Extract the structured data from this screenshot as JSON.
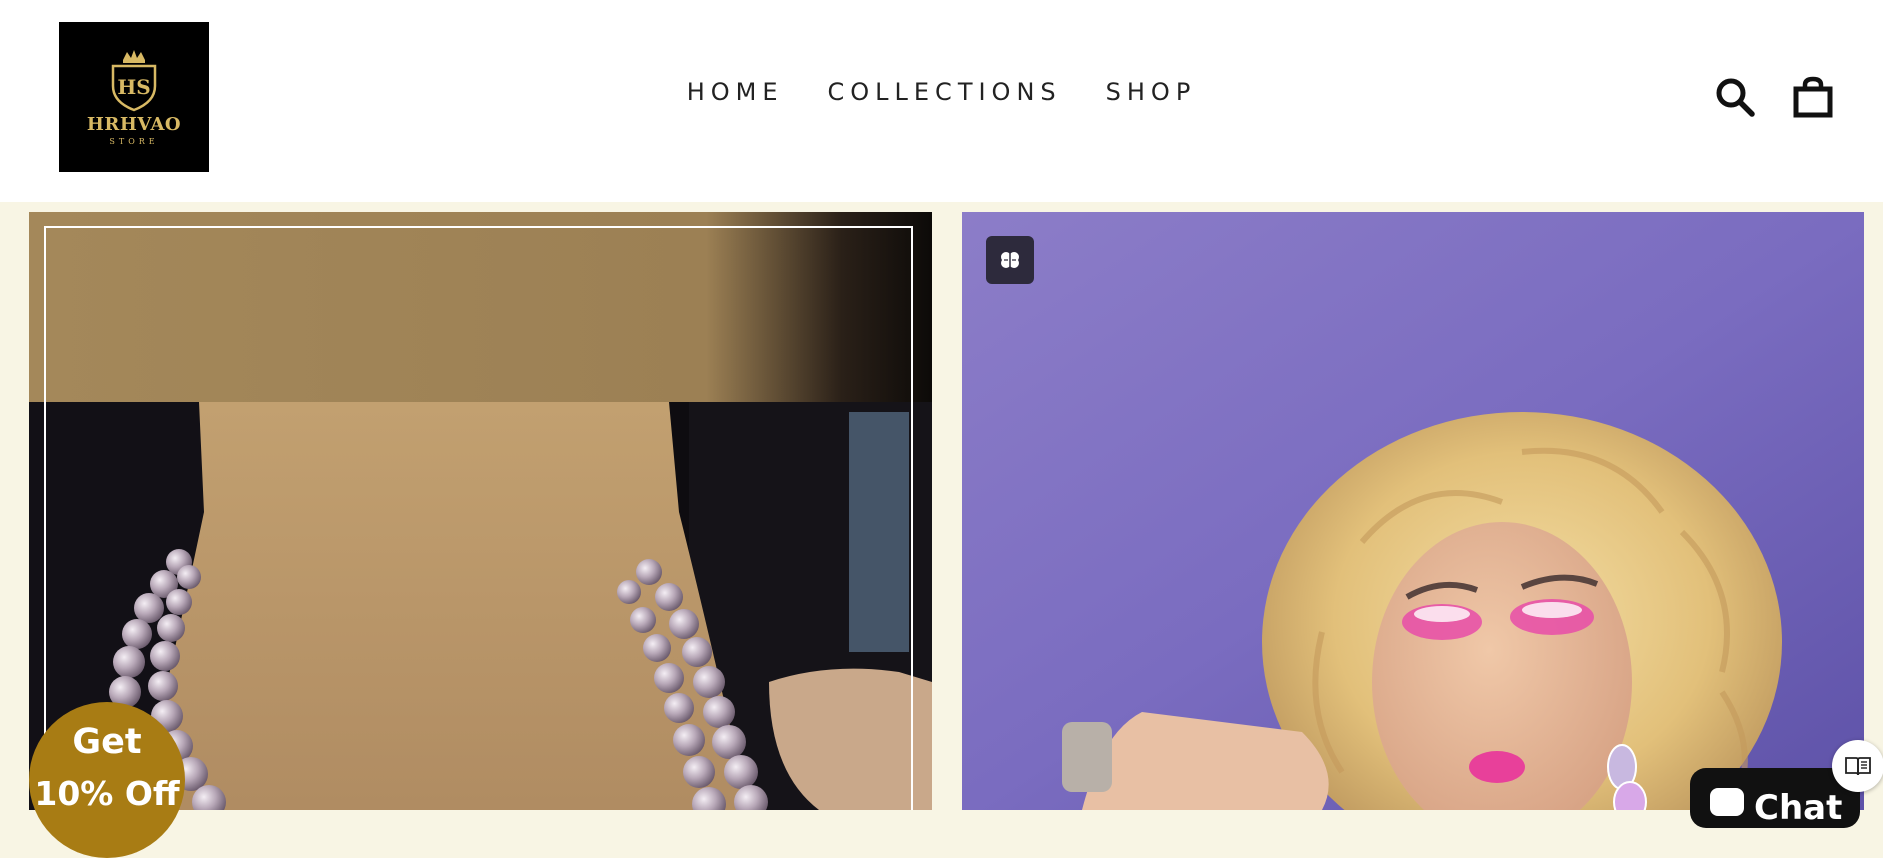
{
  "brand": {
    "logo_initials": "HS",
    "logo_name": "HRHVAO",
    "logo_sub": "STORE",
    "gold": "#d8b964"
  },
  "nav": {
    "items": [
      {
        "label": "HOME"
      },
      {
        "label": "COLLECTIONS"
      },
      {
        "label": "SHOP"
      }
    ]
  },
  "header_icons": {
    "search": "search-icon",
    "cart": "shopping-bag-icon"
  },
  "tiles": [
    {
      "subject": "pearl-necklace-photo",
      "bg": "#a88c60"
    },
    {
      "subject": "drag-queen-portrait-photo",
      "bg": "#7a6cc0"
    }
  ],
  "promo": {
    "line1": "Get",
    "line2": "10% Off",
    "color": "#a87c14"
  },
  "chat": {
    "label": "Chat"
  },
  "colors": {
    "page_bg": "#f8f5e4",
    "header_bg": "#ffffff"
  }
}
